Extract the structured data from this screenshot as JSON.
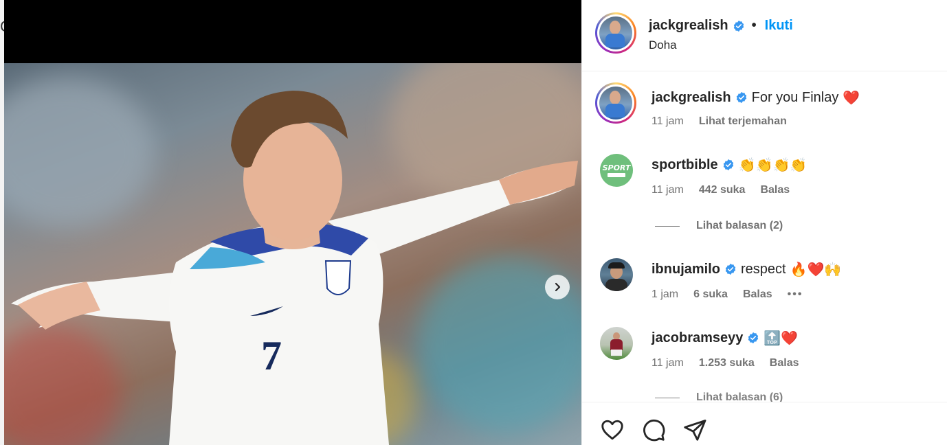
{
  "post": {
    "author": "jackgrealish",
    "follow_label": "Ikuti",
    "separator": "•",
    "location": "Doha"
  },
  "caption": {
    "username": "jackgrealish",
    "text": "For you Finlay",
    "emoji": "❤️",
    "time": "11 jam",
    "translate_label": "Lihat terjemahan"
  },
  "comments": [
    {
      "username": "sportbible",
      "verified": true,
      "text": "",
      "emoji": "👏👏👏👏",
      "time": "11 jam",
      "likes": "442 suka",
      "reply_label": "Balas",
      "view_replies": "Lihat balasan (2)",
      "avatar_text": "SPORT"
    },
    {
      "username": "ibnujamilo",
      "verified": true,
      "text": "respect",
      "emoji": "🔥❤️🙌",
      "time": "1 jam",
      "likes": "6 suka",
      "reply_label": "Balas",
      "more": "•••"
    },
    {
      "username": "jacobramseyy",
      "verified": true,
      "text": "",
      "emoji": "🔝❤️",
      "time": "11 jam",
      "likes": "1.253 suka",
      "reply_label": "Balas",
      "view_replies": "Lihat balasan (6)"
    }
  ],
  "colors": {
    "accent": "#0095f6",
    "verified": "#3897f0",
    "muted": "#737373",
    "sportbible_bg": "#6fbf7c"
  },
  "icons": {
    "like": "heart-icon",
    "comment": "comment-icon",
    "share": "send-icon",
    "next": "chevron-right-icon"
  }
}
